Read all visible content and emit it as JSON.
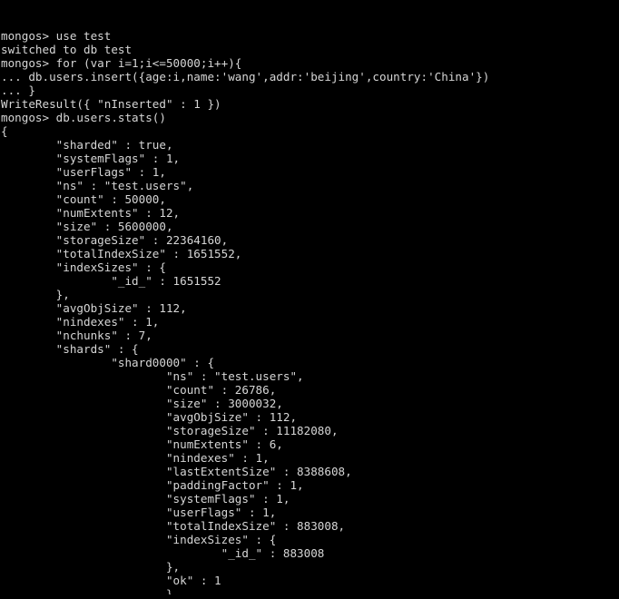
{
  "terminal": {
    "shell_prompt": "mongos>",
    "foreground_color": "#d6d6d6",
    "background_color": "#000000",
    "lines": [
      "mongos> use test",
      "switched to db test",
      "mongos> for (var i=1;i<=50000;i++){",
      "... db.users.insert({age:i,name:'wang',addr:'beijing',country:'China'})",
      "... }",
      "WriteResult({ \"nInserted\" : 1 })",
      "mongos> db.users.stats()",
      "{",
      "        \"sharded\" : true,",
      "        \"systemFlags\" : 1,",
      "        \"userFlags\" : 1,",
      "        \"ns\" : \"test.users\",",
      "        \"count\" : 50000,",
      "        \"numExtents\" : 12,",
      "        \"size\" : 5600000,",
      "        \"storageSize\" : 22364160,",
      "        \"totalIndexSize\" : 1651552,",
      "        \"indexSizes\" : {",
      "                \"_id_\" : 1651552",
      "        },",
      "        \"avgObjSize\" : 112,",
      "        \"nindexes\" : 1,",
      "        \"nchunks\" : 7,",
      "        \"shards\" : {",
      "                \"shard0000\" : {",
      "                        \"ns\" : \"test.users\",",
      "                        \"count\" : 26786,",
      "                        \"size\" : 3000032,",
      "                        \"avgObjSize\" : 112,",
      "                        \"storageSize\" : 11182080,",
      "                        \"numExtents\" : 6,",
      "                        \"nindexes\" : 1,",
      "                        \"lastExtentSize\" : 8388608,",
      "                        \"paddingFactor\" : 1,",
      "                        \"systemFlags\" : 1,",
      "                        \"userFlags\" : 1,",
      "                        \"totalIndexSize\" : 883008,",
      "                        \"indexSizes\" : {",
      "                                \"_id_\" : 883008",
      "                        },",
      "                        \"ok\" : 1"
    ],
    "partial_last_line": "                        }"
  }
}
